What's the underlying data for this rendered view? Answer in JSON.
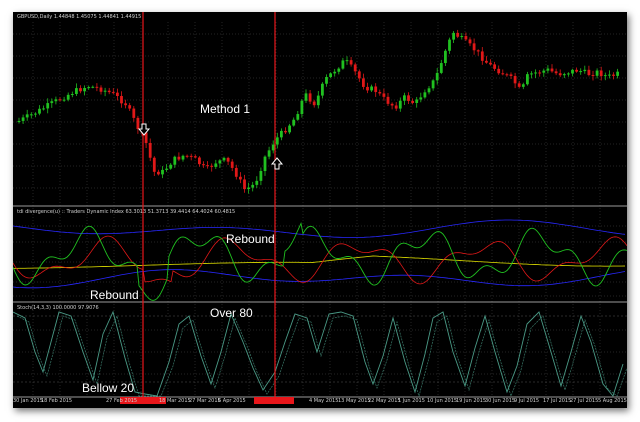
{
  "window": {
    "symbol_timeframe": "GBPUSD,Daily",
    "ohlc": "1.44848 1.45075 1.44841 1.44915"
  },
  "indicators": {
    "tdi_header": "tdi divergence(u) :: Traders Dynamic Index 63.3013 51.3713 39.4414 64.4024 60.4815",
    "stoch_header": "Stoch(14,3,3) 100.0000 97.9076"
  },
  "annotations": {
    "method": "Method 1",
    "rebound_top": "Rebound",
    "rebound_bottom": "Rebound",
    "over": "Over 80",
    "below": "Bellow 20"
  },
  "arrows": {
    "sell_icon": "down-arrow-icon",
    "buy_icon": "up-arrow-icon"
  },
  "x_axis_dates": [
    "30 Jan 2015",
    "18 Feb 2015",
    "27 Feb 2015",
    "18 Mar 2015",
    "27 Mar 2015",
    "6 Apr 2015",
    "4 May 2015",
    "13 May 2015",
    "22 May 2015",
    "1 Jun 2015",
    "10 Jun 2015",
    "19 Jun 2015",
    "30 Jun 2015",
    "9 Jul 2015",
    "17 Jul 2015",
    "27 Jul 2015",
    "5 Aug 2015"
  ],
  "colors": {
    "background": "#000000",
    "bull_candle": "#20c020",
    "bear_candle": "#e01818",
    "vertical_marker": "#e8161a",
    "tdi_yellow": "#c8c800",
    "tdi_green": "#20c020",
    "tdi_red": "#e01818",
    "tdi_blue": "#2828ff",
    "stoch_main": "#4a9a86"
  }
}
